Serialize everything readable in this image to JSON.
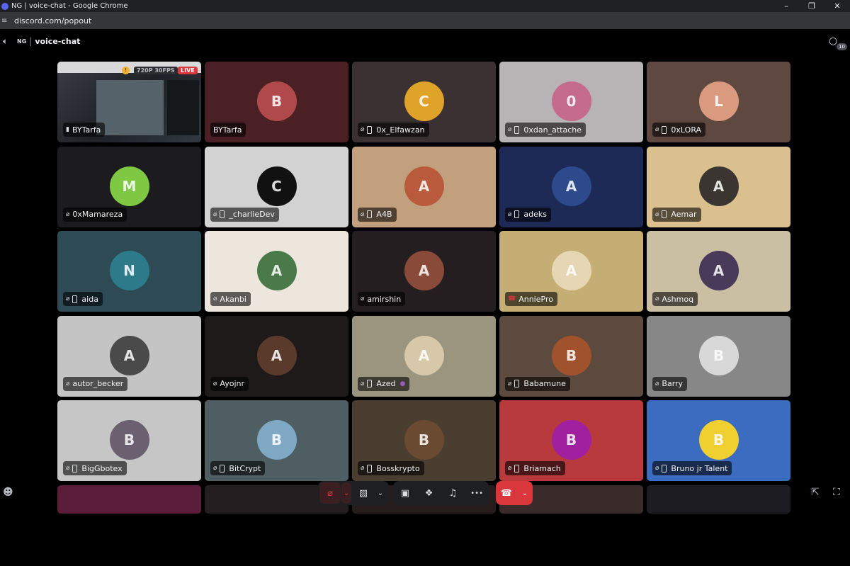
{
  "browser": {
    "title": "NG | voice-chat - Google Chrome",
    "url": "discord.com/popout",
    "controls": [
      "–",
      "❐",
      "✕"
    ]
  },
  "header": {
    "server_tag": "NG",
    "separator": "|",
    "channel": "voice-chat",
    "chat_count": "10"
  },
  "share": {
    "name": "BYTarfa",
    "quality": "720P 30FPS",
    "live": "LIVE"
  },
  "participants": [
    {
      "name": "BYTarfa",
      "initial": "B",
      "bg": "#4a2024",
      "avatar": "#b04a4a",
      "muted": false,
      "phone": false
    },
    {
      "name": "0x_Elfawzan",
      "initial": "C",
      "bg": "#3b3133",
      "avatar": "#e0a32a",
      "muted": true,
      "phone": true
    },
    {
      "name": "0xdan_attache",
      "initial": "0",
      "bg": "#b8b4b6",
      "avatar": "#c46a8a",
      "muted": true,
      "phone": true
    },
    {
      "name": "0xLORA",
      "initial": "L",
      "bg": "#5e4840",
      "avatar": "#d99a80",
      "muted": true,
      "phone": true
    },
    {
      "name": "0xMamareza",
      "initial": "M",
      "bg": "#1c1c1e",
      "avatar": "#7fc843",
      "muted": true,
      "phone": false
    },
    {
      "name": "_charlieDev",
      "initial": "C",
      "bg": "#d2d2d2",
      "avatar": "#111111",
      "muted": true,
      "phone": true
    },
    {
      "name": "A4B",
      "initial": "A",
      "bg": "#c2a07e",
      "avatar": "#b95a3c",
      "muted": true,
      "phone": true
    },
    {
      "name": "adeks",
      "initial": "A",
      "bg": "#1c2a55",
      "avatar": "#2d4a8c",
      "muted": true,
      "phone": true
    },
    {
      "name": "Aemar",
      "initial": "A",
      "bg": "#d9c08e",
      "avatar": "#3a3530",
      "muted": true,
      "phone": true
    },
    {
      "name": "aida",
      "initial": "N",
      "bg": "#2e4a55",
      "avatar": "#2d7a8a",
      "muted": true,
      "phone": true
    },
    {
      "name": "Akanbi",
      "initial": "A",
      "bg": "#ece6dc",
      "avatar": "#4a7a4a",
      "muted": true,
      "phone": false
    },
    {
      "name": "amirshin",
      "initial": "A",
      "bg": "#241e20",
      "avatar": "#8a4a3a",
      "muted": true,
      "phone": false
    },
    {
      "name": "AnniePro",
      "initial": "A",
      "bg": "#c5ae74",
      "avatar": "#e6d6b4",
      "muted": false,
      "phone": false,
      "leave": true
    },
    {
      "name": "Ashmoq",
      "initial": "A",
      "bg": "#cbbfa3",
      "avatar": "#4a3a5a",
      "muted": true,
      "phone": false
    },
    {
      "name": "autor_becker",
      "initial": "A",
      "bg": "#c4c4c4",
      "avatar": "#4a4a4a",
      "muted": true,
      "phone": false
    },
    {
      "name": "Ayojnr",
      "initial": "A",
      "bg": "#1d1a19",
      "avatar": "#5a3a2a",
      "muted": true,
      "phone": false
    },
    {
      "name": "Azed",
      "initial": "A",
      "bg": "#9b9580",
      "avatar": "#d6c8a8",
      "muted": true,
      "phone": true,
      "extra": "●"
    },
    {
      "name": "Babamune",
      "initial": "B",
      "bg": "#5c4a3e",
      "avatar": "#a0522d",
      "muted": true,
      "phone": true
    },
    {
      "name": "Barry",
      "initial": "B",
      "bg": "#878787",
      "avatar": "#d8d8d8",
      "muted": true,
      "phone": false
    },
    {
      "name": "BigGbotex",
      "initial": "B",
      "bg": "#c6c6c6",
      "avatar": "#6a6070",
      "muted": true,
      "phone": true
    },
    {
      "name": "BitCrypt",
      "initial": "B",
      "bg": "#4e5e62",
      "avatar": "#7fa8c4",
      "muted": true,
      "phone": true
    },
    {
      "name": "Bosskrypto",
      "initial": "B",
      "bg": "#4a3e30",
      "avatar": "#6a4a30",
      "muted": true,
      "phone": true
    },
    {
      "name": "Briamach",
      "initial": "B",
      "bg": "#b83a3c",
      "avatar": "#a020a0",
      "muted": true,
      "phone": true
    },
    {
      "name": "Bruno jr Talent",
      "initial": "B",
      "bg": "#3c6cc0",
      "avatar": "#f0d030",
      "muted": true,
      "phone": true
    }
  ],
  "partial_row": [
    "#5a1e3a",
    "#241e20",
    "#261c1c",
    "#3a2a2a",
    "#1c1c22",
    "#2a2040"
  ],
  "controls": {
    "mic_icon": "⌀",
    "camera_icon": "▧",
    "share_icon": "▣",
    "activity_icon": "❖",
    "soundboard_icon": "♫",
    "more_icon": "•••",
    "leave_icon": "☎",
    "caret": "⌄"
  },
  "colors": {
    "accent": "#5865f2",
    "danger": "#da373c",
    "panel": "#1e1f22"
  },
  "icons": {
    "add_user": "add-user-icon",
    "popout": "popout-icon",
    "fullscreen": "fullscreen-icon",
    "chat": "chat-icon"
  }
}
